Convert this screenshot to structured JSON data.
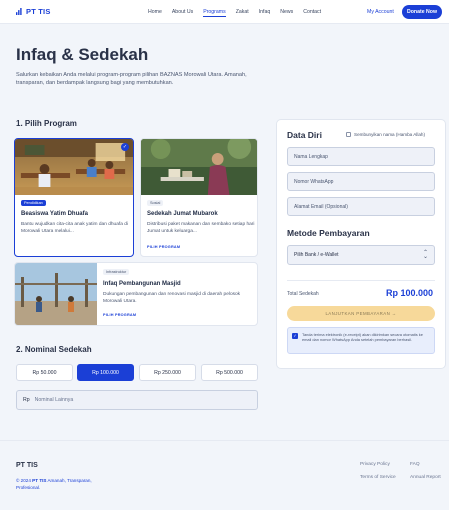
{
  "nav": {
    "brand": "PT TIS",
    "links": [
      "Home",
      "About Us",
      "Programs",
      "Zakat",
      "Infaq",
      "News",
      "Contact"
    ],
    "active_link": "Programs",
    "account": "My Account",
    "donate": "Donate Now"
  },
  "hero": {
    "title": "Infaq & Sedekah",
    "description": "Salurkan kebaikan Anda melalui program-program pilihan BAZNAS Morowali Utara. Amanah, transparan, dan berdampak langsung bagi yang membutuhkan."
  },
  "programs": {
    "section_title": "1. Pilih Program",
    "cards": [
      {
        "tag": "Pendidikan",
        "title": "Beasiswa Yatim Dhuafa",
        "desc": "Bantu wujudkan cita-cita anak yatim dan dhuafa di Morowali Utara melalui...",
        "link": "PILIH PROGRAM",
        "selected": true
      },
      {
        "tag": "Sosial",
        "title": "Sedekah Jumat Mubarok",
        "desc": "Distribusi paket makanan dan sembako setiap hari Jumat untuk keluarga...",
        "link": "PILIH PROGRAM",
        "selected": false
      },
      {
        "tag": "Infrastruktur",
        "title": "Infaq Pembangunan Masjid",
        "desc": "Dukungan pembangunan dan renovasi masjid di daerah pelosok Morowali Utara.",
        "link": "PILIH PROGRAM",
        "selected": false
      }
    ]
  },
  "nominal": {
    "section_title": "2. Nominal Sedekah",
    "options": [
      "Rp 50.000",
      "Rp 100.000",
      "Rp 250.000",
      "Rp 500.000"
    ],
    "active": "Rp 100.000",
    "other_prefix": "Rp",
    "other_placeholder": "Nominal Lainnya"
  },
  "panel": {
    "data_title": "Data Diri",
    "anon_label": "Sembunyikan nama (Hamba Allah)",
    "fields": [
      "Nama Lengkap",
      "Nomor WhatsApp",
      "Alamat Email (Opsional)"
    ],
    "payment_title": "Metode Pembayaran",
    "payment_select": "Pilih Bank / e-Wallet",
    "total_label": "Total Sedekah",
    "total_value": "Rp 100.000",
    "continue_btn": "LANJUTKAN PEMBAYARAN →",
    "notice": "Tanda terima elektronik (e-receipt) akan dikirimkan secara otomatis ke email dan nomor WhatsApp Anda setelah pembayaran berhasil."
  },
  "footer": {
    "brand": "PT TIS",
    "copy_year": "© 2024 ",
    "copy_brand": "PT TIS",
    "copy_tail": " Amanah, Transparan, Profesional.",
    "links": [
      "Privacy Policy",
      "FAQ",
      "Terms of Service",
      "Annual Report"
    ]
  },
  "colors": {
    "accent": "#1b3fd6",
    "button_disabled": "#f7d99a"
  }
}
